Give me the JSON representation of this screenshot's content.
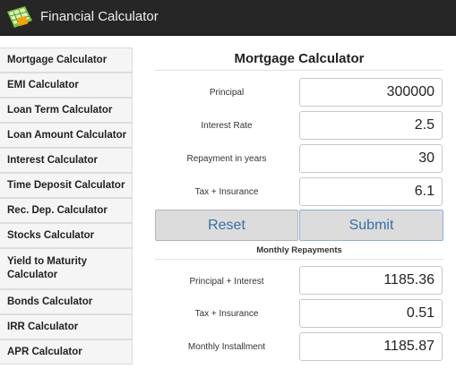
{
  "header": {
    "app_title": "Financial Calculator",
    "logo_icon": "spreadsheet-icon"
  },
  "sidebar": {
    "items": [
      {
        "label": "Mortgage Calculator"
      },
      {
        "label": "EMI Calculator"
      },
      {
        "label": "Loan Term Calculator"
      },
      {
        "label": "Loan Amount Calculator"
      },
      {
        "label": "Interest Calculator"
      },
      {
        "label": "Time Deposit Calculator"
      },
      {
        "label": "Rec. Dep. Calculator"
      },
      {
        "label": "Stocks Calculator"
      },
      {
        "label": "Yield to Maturity Calculator"
      },
      {
        "label": "Bonds Calculator"
      },
      {
        "label": "IRR Calculator"
      },
      {
        "label": "APR Calculator"
      }
    ]
  },
  "main": {
    "title": "Mortgage Calculator",
    "inputs": [
      {
        "label": "Principal",
        "value": "300000"
      },
      {
        "label": "Interest Rate",
        "value": "2.5"
      },
      {
        "label": "Repayment in years",
        "value": "30"
      },
      {
        "label": "Tax + Insurance",
        "value": "6.1"
      }
    ],
    "reset_label": "Reset",
    "submit_label": "Submit",
    "results_heading": "Monthly Repayments",
    "results": [
      {
        "label": "Principal + Interest",
        "value": "1185.36"
      },
      {
        "label": "Tax + Insurance",
        "value": "0.51"
      },
      {
        "label": "Monthly Installment",
        "value": "1185.87"
      }
    ]
  },
  "colors": {
    "header_bg": "#262626",
    "button_text": "#3a6ea5",
    "button_bg": "#dcdcdc"
  }
}
